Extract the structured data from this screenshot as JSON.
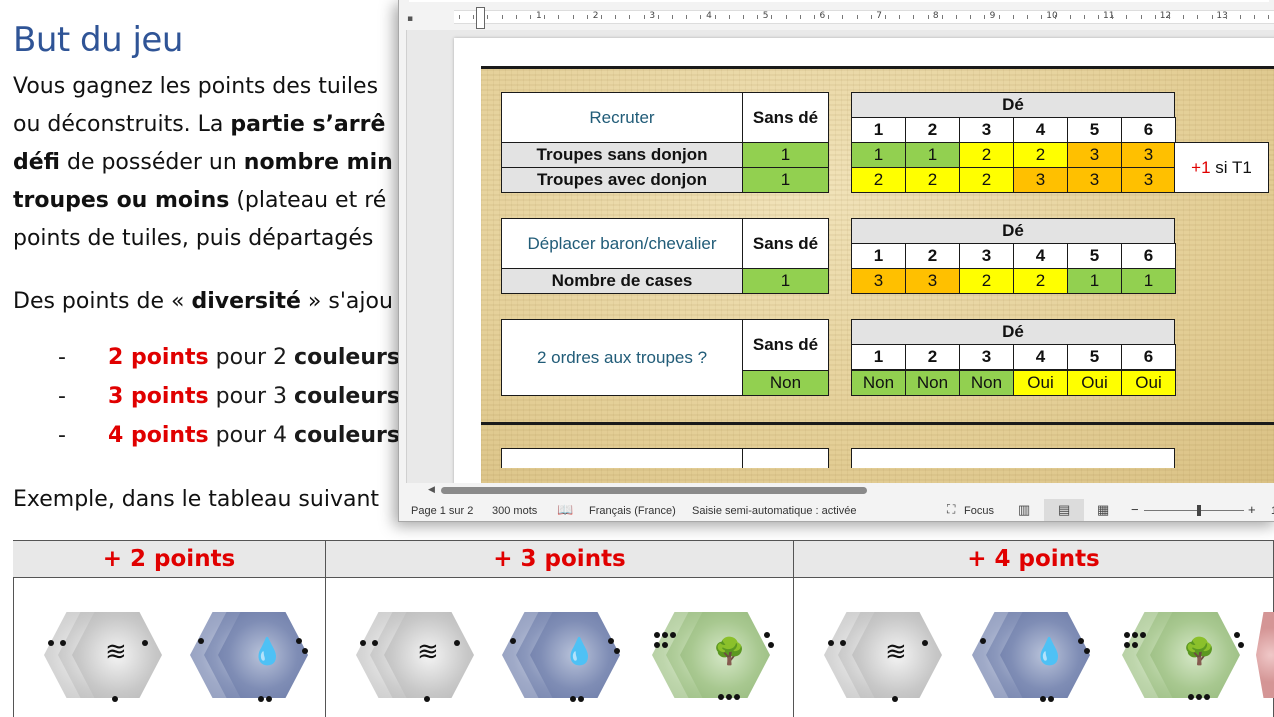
{
  "document": {
    "title": "But du jeu",
    "para1": [
      {
        "parts": [
          {
            "t": "Vous gagnez les points des tuiles",
            "b": false
          }
        ]
      },
      {
        "parts": [
          {
            "t": "ou déconstruits. La ",
            "b": false
          },
          {
            "t": "partie s’arrê",
            "b": true
          }
        ]
      },
      {
        "parts": [
          {
            "t": "défi",
            "b": true
          },
          {
            "t": " de posséder un ",
            "b": false
          },
          {
            "t": "nombre min",
            "b": true
          }
        ]
      },
      {
        "parts": [
          {
            "t": "troupes ou moins",
            "b": true
          },
          {
            "t": " (plateau et ré",
            "b": false
          }
        ]
      },
      {
        "parts": [
          {
            "t": "points de tuiles, puis départagés",
            "b": false
          }
        ]
      }
    ],
    "diversity_pre": "Des points de « ",
    "diversity_bold": "diversité",
    "diversity_post": " » s'ajou",
    "bullets": [
      {
        "dash": "-",
        "points": "2 points",
        "mid": " pour 2 ",
        "bold": "couleurs"
      },
      {
        "dash": "-",
        "points": "3 points",
        "mid": " pour 3 ",
        "bold": "couleurs"
      },
      {
        "dash": "-",
        "points": "4 points",
        "mid": " pour 4 ",
        "bold": "couleurs"
      }
    ],
    "example_text": "Exemple, dans le tableau suivant",
    "points_table": {
      "headers": [
        "+ 2 points",
        "+ 3 points",
        "+ 4 points"
      ]
    }
  },
  "tile_icons": {
    "wind": "≋",
    "water": "💧",
    "tree": "🌳"
  },
  "word_window": {
    "ruler_numbers": [
      "1",
      "2",
      "3",
      "4",
      "5",
      "6",
      "7",
      "8",
      "9",
      "10",
      "11",
      "12",
      "13",
      "1"
    ],
    "table1": {
      "title": "Recruter",
      "sans_de": "Sans dé",
      "de": "Dé",
      "dice": [
        "1",
        "2",
        "3",
        "4",
        "5",
        "6"
      ],
      "rows": [
        {
          "label": "Troupes sans donjon",
          "sans": "1",
          "vals": [
            "1",
            "1",
            "2",
            "2",
            "3",
            "3"
          ]
        },
        {
          "label": "Troupes avec donjon",
          "sans": "1",
          "vals": [
            "2",
            "2",
            "2",
            "3",
            "3",
            "3"
          ]
        }
      ],
      "bonus_plus": "+1",
      "bonus_text": " si T1"
    },
    "table2": {
      "title": "Déplacer baron/chevalier",
      "sans_de": "Sans dé",
      "de": "Dé",
      "dice": [
        "1",
        "2",
        "3",
        "4",
        "5",
        "6"
      ],
      "row": {
        "label": "Nombre de cases",
        "sans": "1",
        "vals": [
          "3",
          "3",
          "2",
          "2",
          "1",
          "1"
        ]
      }
    },
    "table3": {
      "title": "2 ordres aux troupes ?",
      "sans_de": "Sans dé",
      "de": "Dé",
      "dice": [
        "1",
        "2",
        "3",
        "4",
        "5",
        "6"
      ],
      "sans": "Non",
      "vals": [
        "Non",
        "Non",
        "Non",
        "Oui",
        "Oui",
        "Oui"
      ]
    },
    "status_bar": {
      "page": "Page 1 sur 2",
      "words": "300 mots",
      "language": "Français (France)",
      "autocomplete": "Saisie semi-automatique : activée",
      "focus": "Focus",
      "zoom_minus": "−",
      "zoom_plus": "+",
      "zoom_edge": "1"
    }
  },
  "colors": {
    "heading_blue": "#2f5496",
    "points_red": "#e00000",
    "green": "#92d050",
    "yellow": "#ffff00",
    "orange": "#ffc000",
    "teal_title": "#215c78"
  }
}
